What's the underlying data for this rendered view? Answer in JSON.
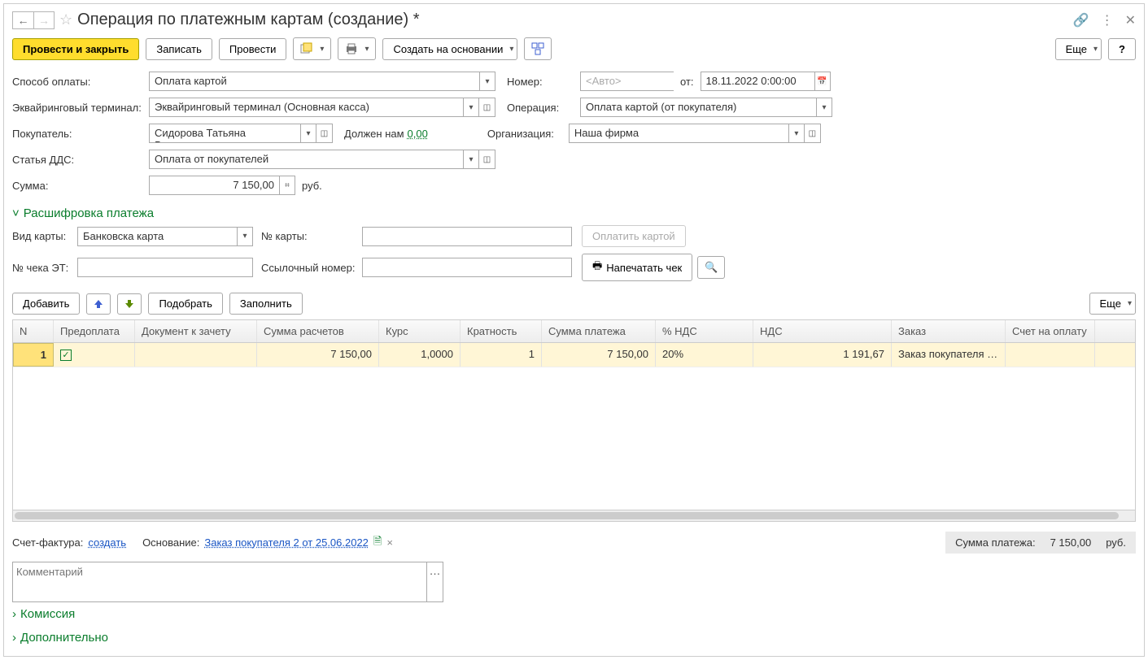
{
  "title": "Операция по платежным картам (создание) *",
  "toolbar": {
    "post_close": "Провести и закрыть",
    "write": "Записать",
    "post": "Провести",
    "create_based": "Создать на основании",
    "more": "Еще",
    "help": "?"
  },
  "fields": {
    "payment_method_label": "Способ оплаты:",
    "payment_method": "Оплата картой",
    "number_label": "Номер:",
    "number_placeholder": "<Авто>",
    "date_prefix": "от:",
    "date": "18.11.2022  0:00:00",
    "terminal_label": "Эквайринговый терминал:",
    "terminal": "Эквайринговый терминал  (Основная касса)",
    "operation_label": "Операция:",
    "operation": "Оплата картой (от покупателя)",
    "buyer_label": "Покупатель:",
    "buyer": "Сидорова Татьяна Викторовн",
    "debt_label": "Должен нам",
    "debt_value": "0,00",
    "org_label": "Организация:",
    "org": "Наша фирма",
    "dds_label": "Статья ДДС:",
    "dds": "Оплата от покупателей",
    "sum_label": "Сумма:",
    "sum": "7 150,00",
    "currency": "руб."
  },
  "section_decrypt": "Расшифровка платежа",
  "card": {
    "type_label": "Вид карты:",
    "type": "Банковска карта",
    "number_label": "№ карты:",
    "pay_btn": "Оплатить картой",
    "check_label": "№ чека ЭТ:",
    "ref_label": "Ссылочный номер:",
    "print_btn": "Напечатать чек"
  },
  "table_toolbar": {
    "add": "Добавить",
    "pick": "Подобрать",
    "fill": "Заполнить",
    "more": "Еще"
  },
  "table": {
    "headers": [
      "N",
      "Предоплата",
      "Документ к зачету",
      "Сумма расчетов",
      "Курс",
      "Кратность",
      "Сумма платежа",
      "% НДС",
      "НДС",
      "Заказ",
      "Счет на оплату"
    ],
    "row": {
      "n": "1",
      "prepay": true,
      "doc": "",
      "sum_calc": "7 150,00",
      "rate": "1,0000",
      "mult": "1",
      "sum_pay": "7 150,00",
      "vat_pct": "20%",
      "vat": "1 191,67",
      "order": "Заказ покупателя …",
      "invoice": ""
    }
  },
  "footer": {
    "sf_label": "Счет-фактура:",
    "sf_link": "создать",
    "basis_label": "Основание:",
    "basis_link": "Заказ покупателя 2 от 25.06.2022",
    "total_label": "Сумма платежа:",
    "total_value": "7 150,00",
    "total_cur": "руб.",
    "comment_placeholder": "Комментарий"
  },
  "section_commission": "Комиссия",
  "section_additional": "Дополнительно"
}
